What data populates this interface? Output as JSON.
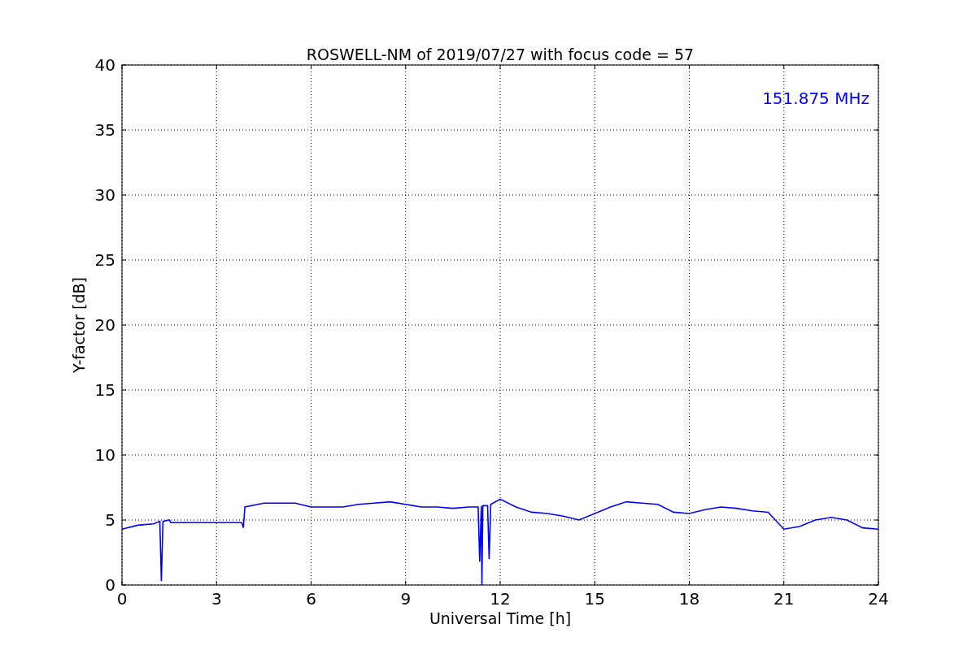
{
  "figure": {
    "chart_data": {
      "type": "line",
      "title": "ROSWELL-NM of 2019/07/27 with focus code = 57",
      "xlabel": "Universal Time [h]",
      "ylabel": "Y-factor [dB]",
      "x": [
        0,
        0.5,
        1.0,
        1.2,
        1.25,
        1.3,
        1.5,
        1.55,
        3.8,
        3.85,
        3.9,
        4.5,
        5,
        5.5,
        6,
        6.5,
        7,
        7.5,
        8,
        8.5,
        9,
        9.5,
        10,
        10.5,
        11,
        11.3,
        11.35,
        11.4,
        11.42,
        11.45,
        11.6,
        11.65,
        11.7,
        12,
        12.5,
        13,
        13.5,
        14,
        14.5,
        15,
        15.5,
        16,
        16.5,
        17,
        17.5,
        18,
        18.5,
        19,
        19.5,
        20,
        20.5,
        21,
        21.5,
        22,
        22.5,
        23,
        23.5,
        24
      ],
      "series": [
        {
          "name": "151.875 MHz",
          "color": "#0000ff",
          "values": [
            4.3,
            4.6,
            4.7,
            4.9,
            0.3,
            4.9,
            5.0,
            4.8,
            4.8,
            4.4,
            6.0,
            6.3,
            6.3,
            6.3,
            6.0,
            6.0,
            6.0,
            6.2,
            6.3,
            6.4,
            6.2,
            6.0,
            6.0,
            5.9,
            6.0,
            6.0,
            1.8,
            6.1,
            0,
            6.1,
            6.1,
            2.0,
            6.2,
            6.6,
            6.0,
            5.6,
            5.5,
            5.3,
            5.0,
            5.5,
            6.0,
            6.4,
            6.3,
            6.2,
            5.6,
            5.5,
            5.8,
            6.0,
            5.9,
            5.7,
            5.6,
            4.3,
            4.5,
            5.0,
            5.2,
            5.0,
            4.4,
            4.3
          ]
        }
      ],
      "xlim": [
        0,
        24
      ],
      "ylim": [
        0,
        40
      ],
      "xticks": [
        0,
        3,
        6,
        9,
        12,
        15,
        18,
        21,
        24
      ],
      "yticks": [
        0,
        5,
        10,
        15,
        20,
        25,
        30,
        35,
        40
      ],
      "grid": true
    }
  }
}
